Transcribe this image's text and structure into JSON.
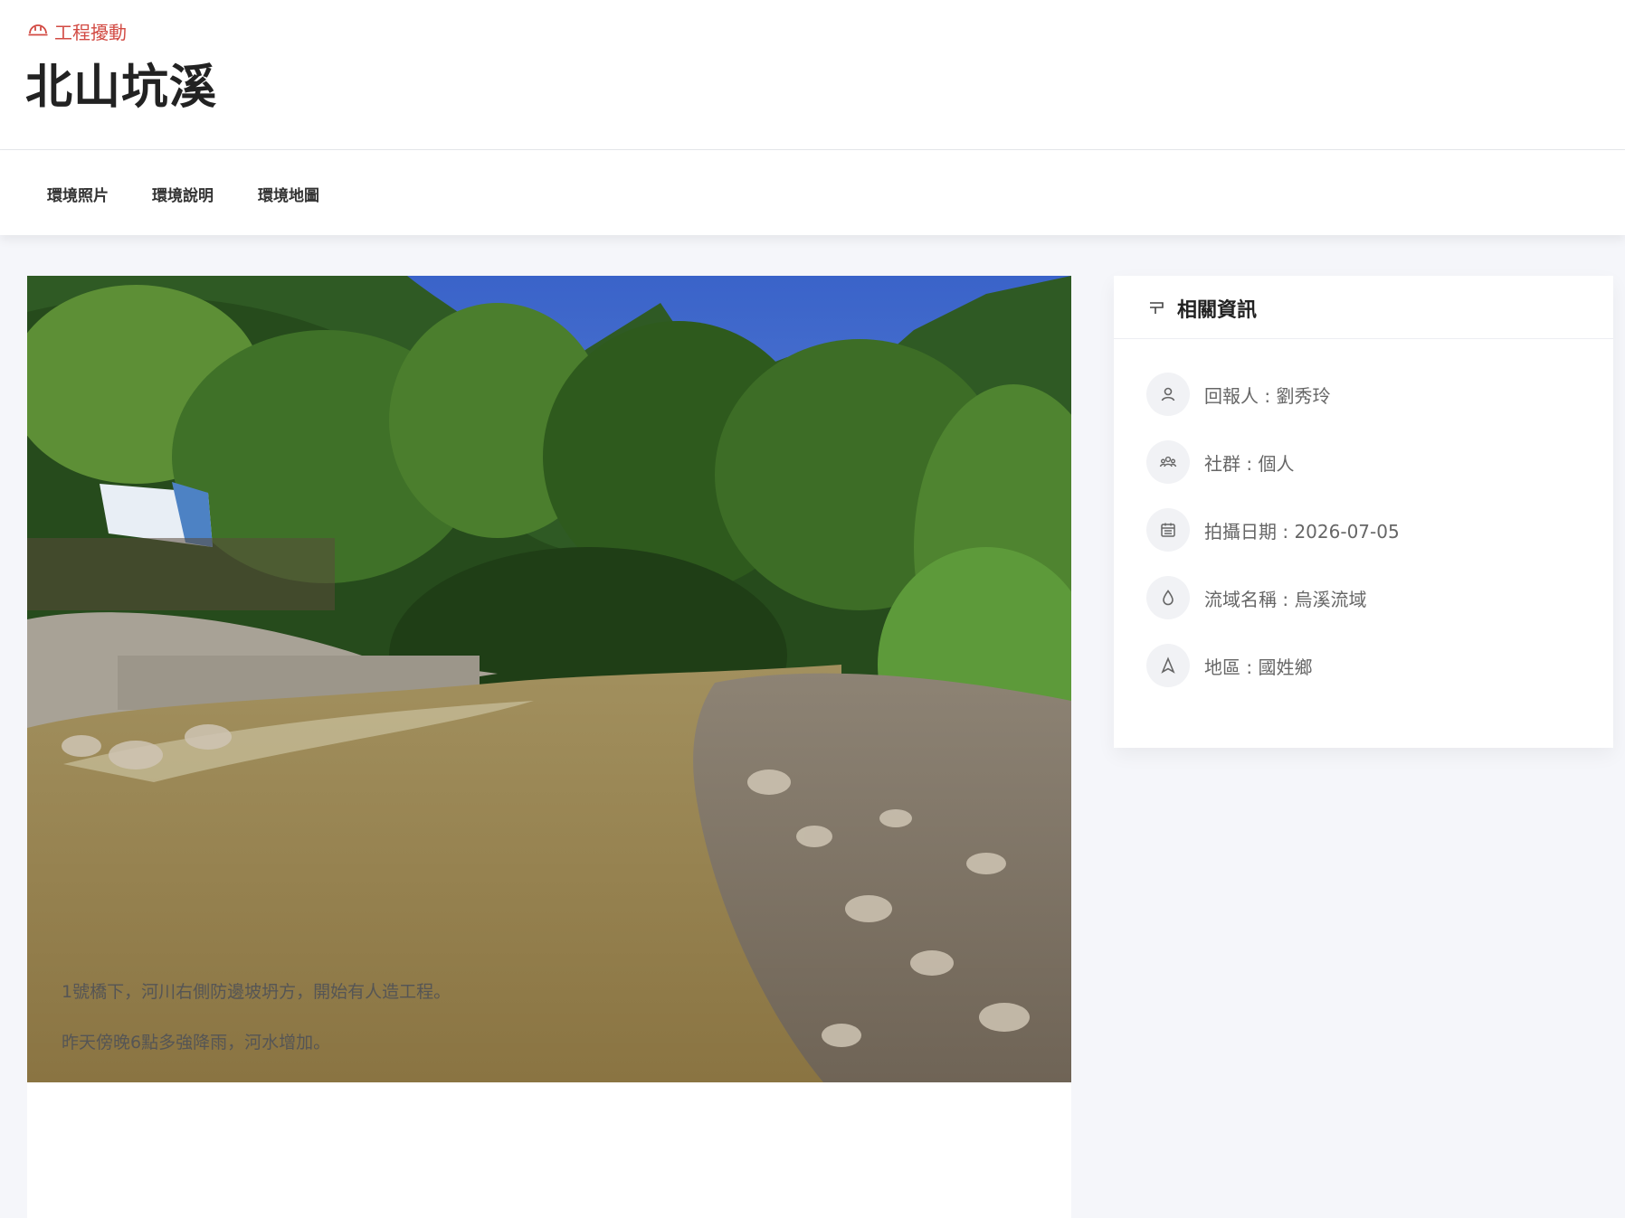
{
  "header": {
    "category": "工程擾動",
    "category_icon": "hardhat-icon",
    "title": "北山坑溪"
  },
  "tabs": [
    {
      "label": "環境照片"
    },
    {
      "label": "環境說明"
    },
    {
      "label": "環境地圖"
    }
  ],
  "photo": {
    "description_lines": [
      "1號橋下，河川右側防邊坡坍方，開始有人造工程。",
      "昨天傍晚6點多強降雨，河水增加。"
    ]
  },
  "info": {
    "title": "相關資訊",
    "rows": [
      {
        "icon": "user-icon",
        "text": "回報人 : 劉秀玲"
      },
      {
        "icon": "group-icon",
        "text": "社群 : 個人"
      },
      {
        "icon": "calendar-icon",
        "text": "拍攝日期 : 2026-07-05"
      },
      {
        "icon": "droplet-icon",
        "text": "流域名稱 : 烏溪流域"
      },
      {
        "icon": "location-arrow-icon",
        "text": "地區 : 國姓鄉"
      }
    ]
  },
  "colors": {
    "accent": "#d24a43",
    "page_bg": "#f5f6fa",
    "card_bg": "#ffffff"
  }
}
